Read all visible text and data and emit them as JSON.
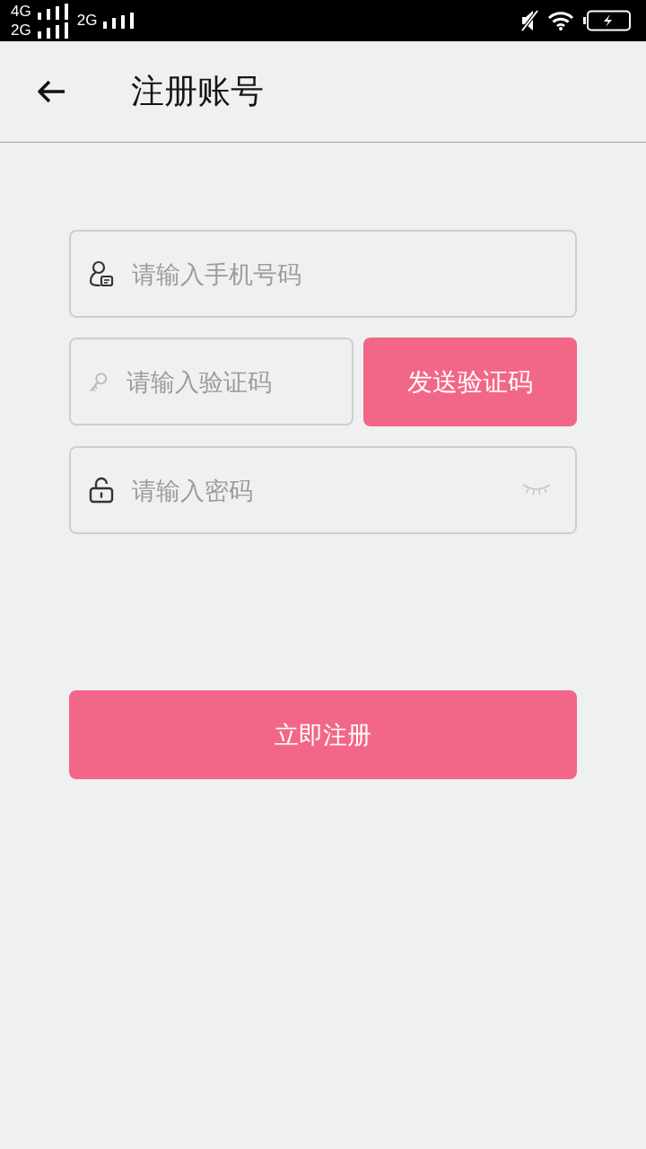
{
  "status_bar": {
    "sims": [
      {
        "lines": [
          "4G",
          "2G"
        ]
      },
      {
        "lines": [
          "2G"
        ]
      }
    ],
    "battery": {
      "charging": true
    }
  },
  "header": {
    "title": "注册账号"
  },
  "form": {
    "fields": [
      {
        "kind": "phone",
        "placeholder": "请输入手机号码"
      },
      {
        "kind": "code",
        "placeholder": "请输入验证码",
        "button": "发送验证码"
      },
      {
        "kind": "password",
        "placeholder": "请输入密码",
        "password_visible": false
      }
    ]
  },
  "submit_button": "立即注册"
}
